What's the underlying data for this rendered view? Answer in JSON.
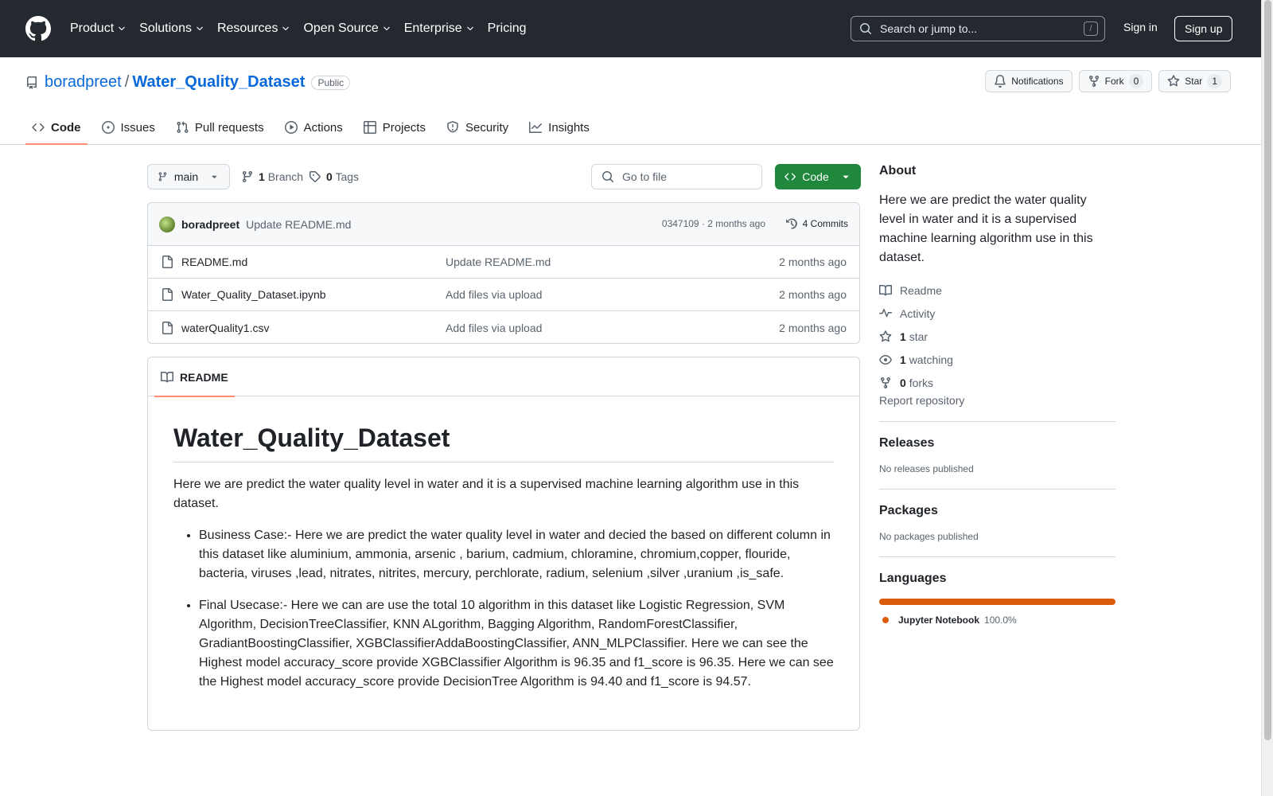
{
  "header": {
    "nav": [
      {
        "label": "Product",
        "dropdown": true
      },
      {
        "label": "Solutions",
        "dropdown": true
      },
      {
        "label": "Resources",
        "dropdown": true
      },
      {
        "label": "Open Source",
        "dropdown": true
      },
      {
        "label": "Enterprise",
        "dropdown": true
      },
      {
        "label": "Pricing",
        "dropdown": false
      }
    ],
    "search_placeholder": "Search or jump to...",
    "search_shortcut": "/",
    "signin": "Sign in",
    "signup": "Sign up"
  },
  "repo": {
    "owner": "boradpreet",
    "separator": "/",
    "name": "Water_Quality_Dataset",
    "visibility": "Public",
    "notifications_label": "Notifications",
    "fork_label": "Fork",
    "fork_count": "0",
    "star_label": "Star",
    "star_count": "1"
  },
  "tabs": [
    {
      "label": "Code",
      "icon": "code-icon",
      "active": true
    },
    {
      "label": "Issues",
      "icon": "issue-icon",
      "active": false
    },
    {
      "label": "Pull requests",
      "icon": "pull-request-icon",
      "active": false
    },
    {
      "label": "Actions",
      "icon": "play-icon",
      "active": false
    },
    {
      "label": "Projects",
      "icon": "table-icon",
      "active": false
    },
    {
      "label": "Security",
      "icon": "shield-icon",
      "active": false
    },
    {
      "label": "Insights",
      "icon": "graph-icon",
      "active": false
    }
  ],
  "branchbar": {
    "branch": "main",
    "branch_count": "1",
    "branch_label": "Branch",
    "tag_count": "0",
    "tag_label": "Tags",
    "goto_placeholder": "Go to file",
    "code_button": "Code"
  },
  "commit": {
    "author": "boradpreet",
    "message": "Update README.md",
    "meta": "0347109 · 2 months ago",
    "commits_label": "4 Commits"
  },
  "files": [
    {
      "name": "README.md",
      "message": "Update README.md",
      "date": "2 months ago"
    },
    {
      "name": "Water_Quality_Dataset.ipynb",
      "message": "Add files via upload",
      "date": "2 months ago"
    },
    {
      "name": "waterQuality1.csv",
      "message": "Add files via upload",
      "date": "2 months ago"
    }
  ],
  "readme": {
    "tab_label": "README",
    "title": "Water_Quality_Dataset",
    "intro": "Here we are predict the water quality level in water and it is a supervised machine learning algorithm use in this dataset.",
    "bullets": [
      "Business Case:- Here we are predict the water quality level in water and decied the based on different column in this dataset like aluminium, ammonia, arsenic , barium, cadmium, chloramine, chromium,copper, flouride, bacteria, viruses ,lead, nitrates, nitrites, mercury, perchlorate, radium, selenium ,silver ,uranium ,is_safe.",
      "Final Usecase:- Here we can are use the total 10 algorithm in this dataset like Logistic Regression, SVM Algorithm, DecisionTreeClassifier, KNN ALgorithm, Bagging Algorithm, RandomForestClassifier, GradiantBoostingClassifier, XGBClassifierAddaBoostingClassifier, ANN_MLPClassifier. Here we can see the Highest model accuracy_score provide XGBClassifier Algorithm is 96.35 and f1_score is 96.35. Here we can see the Highest model accuracy_score provide DecisionTree Algorithm is 94.40 and f1_score is 94.57."
    ]
  },
  "sidebar": {
    "about_heading": "About",
    "about_text": "Here we are predict the water quality level in water and it is a supervised machine learning algorithm use in this dataset.",
    "readme_link": "Readme",
    "activity_link": "Activity",
    "stars_count": "1",
    "stars_label": "star",
    "watching_count": "1",
    "watching_label": "watching",
    "forks_count": "0",
    "forks_label": "forks",
    "report": "Report repository",
    "releases_heading": "Releases",
    "releases_text": "No releases published",
    "packages_heading": "Packages",
    "packages_text": "No packages published",
    "languages_heading": "Languages",
    "language_name": "Jupyter Notebook",
    "language_percent": "100.0%",
    "language_fraction": 1.0,
    "language_color": "#DA5B0B"
  },
  "colors": {
    "header_bg": "#24292f",
    "link": "#0969da",
    "primary_button": "#1f883d",
    "active_tab_underline": "#fd8c73"
  }
}
